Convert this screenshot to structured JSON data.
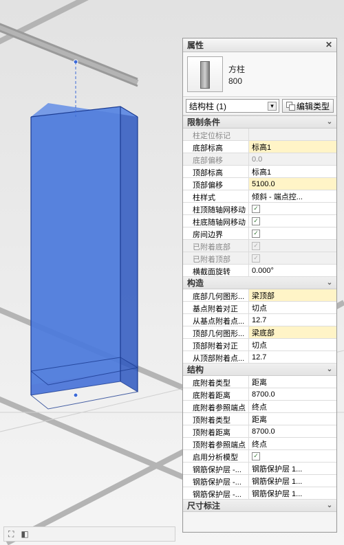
{
  "palette": {
    "title": "属性",
    "type": {
      "family": "方柱",
      "type_name": "800"
    },
    "instance_filter": "结构柱 (1)",
    "edit_type_label": "编辑类型"
  },
  "groups": [
    {
      "name": "限制条件",
      "rows": [
        {
          "label": "柱定位标记",
          "value": "",
          "disabled": true
        },
        {
          "label": "底部标高",
          "value": "标高1",
          "highlight": true
        },
        {
          "label": "底部偏移",
          "value": "0.0",
          "disabled": true
        },
        {
          "label": "顶部标高",
          "value": "标高1"
        },
        {
          "label": "顶部偏移",
          "value": "5100.0",
          "highlight": true
        },
        {
          "label": "柱样式",
          "value": "倾斜 - 端点控..."
        },
        {
          "label": "柱顶随轴网移动",
          "value_checkbox": true
        },
        {
          "label": "柱底随轴网移动",
          "value_checkbox": true
        },
        {
          "label": "房间边界",
          "value_checkbox": true
        },
        {
          "label": "已附着底部",
          "value_checkbox": true,
          "disabled": true
        },
        {
          "label": "已附着顶部",
          "value_checkbox": true,
          "disabled": true
        },
        {
          "label": "横截面旋转",
          "value": "0.000°"
        }
      ]
    },
    {
      "name": "构造",
      "rows": [
        {
          "label": "底部几何图形...",
          "value": "梁顶部",
          "highlight": true
        },
        {
          "label": "基点附着对正",
          "value": "切点"
        },
        {
          "label": "从基点附着点...",
          "value": "12.7"
        },
        {
          "label": "顶部几何图形...",
          "value": "梁底部",
          "highlight": true
        },
        {
          "label": "顶部附着对正",
          "value": "切点"
        },
        {
          "label": "从顶部附着点...",
          "value": "12.7"
        }
      ]
    },
    {
      "name": "结构",
      "rows": [
        {
          "label": "底附着类型",
          "value": "距离"
        },
        {
          "label": "底附着距离",
          "value": "8700.0"
        },
        {
          "label": "底附着参照端点",
          "value": "终点"
        },
        {
          "label": "顶附着类型",
          "value": "距离"
        },
        {
          "label": "顶附着距离",
          "value": "8700.0"
        },
        {
          "label": "顶附着参照端点",
          "value": "终点"
        },
        {
          "label": "启用分析模型",
          "value_checkbox": true
        },
        {
          "label": "钢筋保护层 -...",
          "value": "钢筋保护层 1..."
        },
        {
          "label": "钢筋保护层 -...",
          "value": "钢筋保护层 1..."
        },
        {
          "label": "钢筋保护层 -...",
          "value": "钢筋保护层 1..."
        }
      ]
    },
    {
      "name": "尺寸标注",
      "rows": []
    }
  ]
}
